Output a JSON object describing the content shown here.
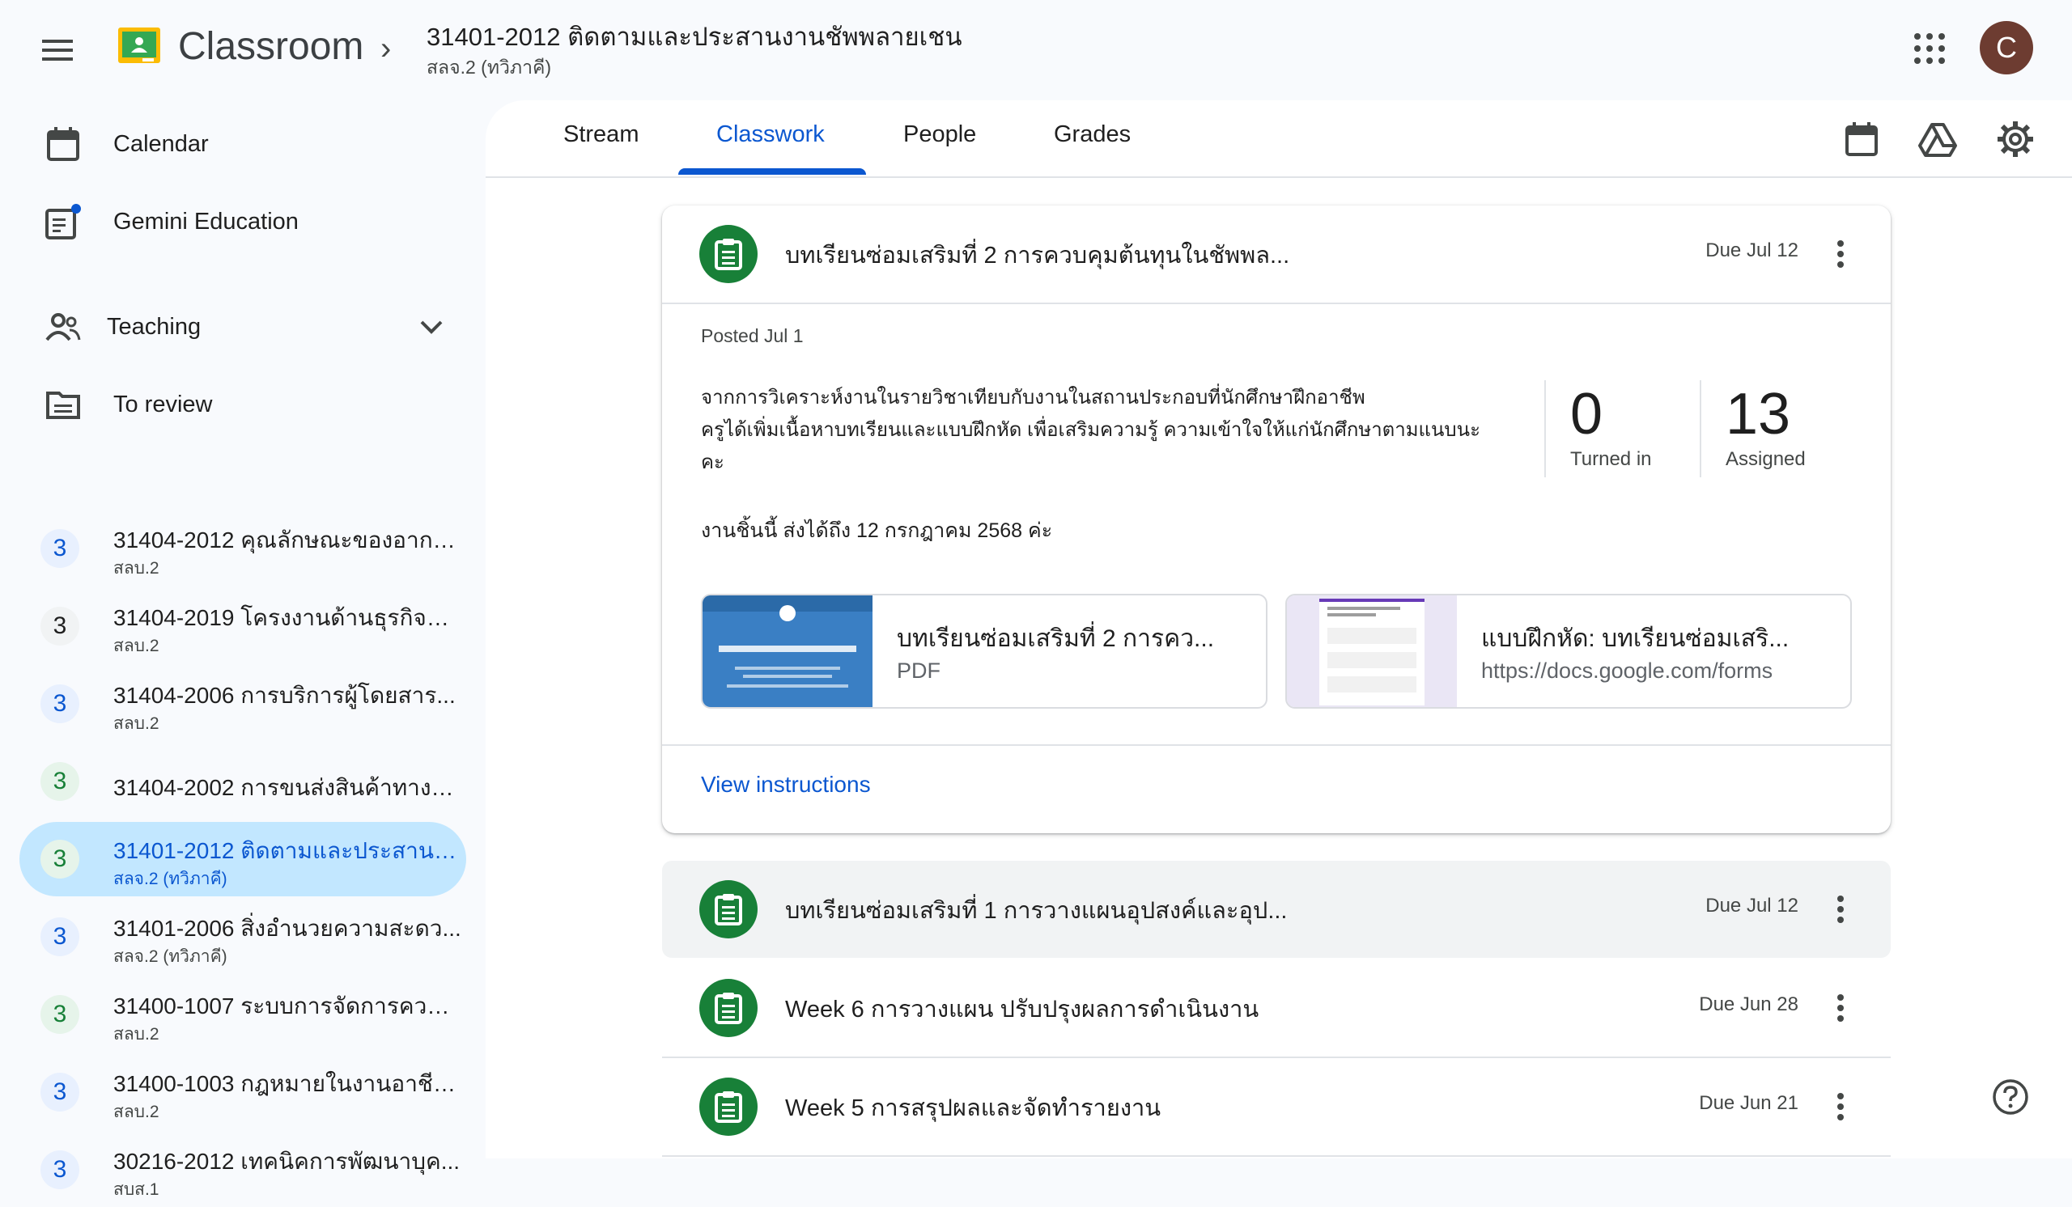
{
  "app": {
    "title": "Classroom"
  },
  "course": {
    "title": "31401-2012 ติดตามและประสานงานชัพพลายเชน",
    "section": "สลจ.2 (ทวิภาคี)"
  },
  "user": {
    "initial": "C"
  },
  "sidebar": {
    "calendar": "Calendar",
    "gemini": "Gemini Education",
    "teaching": "Teaching",
    "to_review": "To review",
    "courses": [
      {
        "badge": "3",
        "title": "31404-2012 คุณลักษณะของอากา...",
        "sub": "สลบ.2",
        "color": "#e8f0fe",
        "fg": "#0b57d0"
      },
      {
        "badge": "3",
        "title": "31404-2019 โครงงานด้านธุรกิจกา...",
        "sub": "สลบ.2",
        "color": "#f1f3f4",
        "fg": "#1f1f1f"
      },
      {
        "badge": "3",
        "title": "31404-2006 การบริการผู้โดยสาร...",
        "sub": "สลบ.2",
        "color": "#e8f0fe",
        "fg": "#0b57d0"
      },
      {
        "badge": "3",
        "title": "31404-2002 การขนส่งสินค้าทางอ...",
        "sub": "",
        "color": "#e6f4ea",
        "fg": "#188038"
      },
      {
        "badge": "3",
        "title": "31401-2012 ติดตามและประสานงา...",
        "sub": "สลจ.2 (ทวิภาคี)",
        "color": "#e6f4ea",
        "fg": "#188038",
        "active": true
      },
      {
        "badge": "3",
        "title": "31401-2006 สิ่งอำนวยความสะดว...",
        "sub": "สลจ.2 (ทวิภาคี)",
        "color": "#e8f0fe",
        "fg": "#0b57d0"
      },
      {
        "badge": "3",
        "title": "31400-1007 ระบบการจัดการความ...",
        "sub": "สลบ.2",
        "color": "#e6f4ea",
        "fg": "#188038"
      },
      {
        "badge": "3",
        "title": "31400-1003 กฎหมายในงานอาชีพ...",
        "sub": "สลบ.2",
        "color": "#e8f0fe",
        "fg": "#0b57d0"
      },
      {
        "badge": "3",
        "title": "30216-2012 เทคนิคการพัฒนาบุค...",
        "sub": "สบส.1",
        "color": "#e8f0fe",
        "fg": "#0b57d0"
      }
    ]
  },
  "tabs": [
    "Stream",
    "Classwork",
    "People",
    "Grades"
  ],
  "expanded": {
    "title": "บทเรียนซ่อมเสริมที่ 2 การควบคุมต้นทุนในชัพพล...",
    "due": "Due Jul 12",
    "posted": "Posted Jul 1",
    "desc_1": "จากการวิเคราะห์งานในรายวิชาเทียบกับงานในสถานประกอบที่นักศึกษาฝึกอาชีพ",
    "desc_2": "ครูได้เพิ่มเนื้อหาบทเรียนและแบบฝึกหัด เพื่อเสริมความรู้ ความเข้าใจให้แก่นักศึกษาตามแนบนะ",
    "desc_3": "คะ",
    "deadline": "งานชิ้นนี้ ส่งได้ถึง 12 กรกฎาคม 2568 ค่ะ",
    "turned_in": {
      "num": "0",
      "label": "Turned in"
    },
    "assigned": {
      "num": "13",
      "label": "Assigned"
    },
    "attachments": [
      {
        "title": "บทเรียนซ่อมเสริมที่ 2 การคว...",
        "sub": "PDF"
      },
      {
        "title": "แบบฝึกหัด: บทเรียนซ่อมเสริ...",
        "sub": "https://docs.google.com/forms"
      }
    ],
    "view_instructions": "View instructions"
  },
  "items": [
    {
      "title": "บทเรียนซ่อมเสริมที่ 1 การวางแผนอุปสงค์และอุป...",
      "due": "Due Jul 12"
    },
    {
      "title": "Week 6 การวางแผน ปรับปรุงผลการดำเนินงาน",
      "due": "Due Jun 28"
    },
    {
      "title": "Week 5 การสรุปผลและจัดทำรายงาน",
      "due": "Due Jun 21"
    }
  ]
}
